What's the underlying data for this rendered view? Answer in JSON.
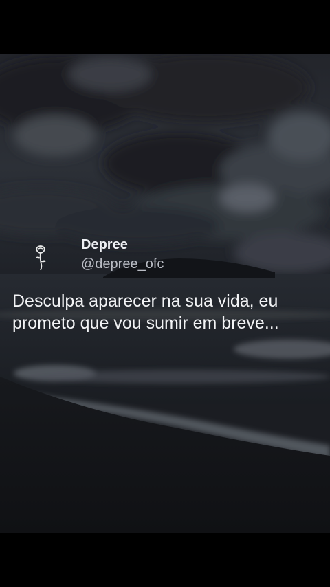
{
  "post": {
    "avatar_icon": "rose-icon",
    "author_name": "Depree",
    "author_handle": "@depree_ofc",
    "text": "Desculpa aparecer na sua vida, eu prometo que vou sumir em breve..."
  },
  "colors": {
    "background": "#000000",
    "text": "#f2f3f5",
    "handle": "#b9bcc4"
  }
}
